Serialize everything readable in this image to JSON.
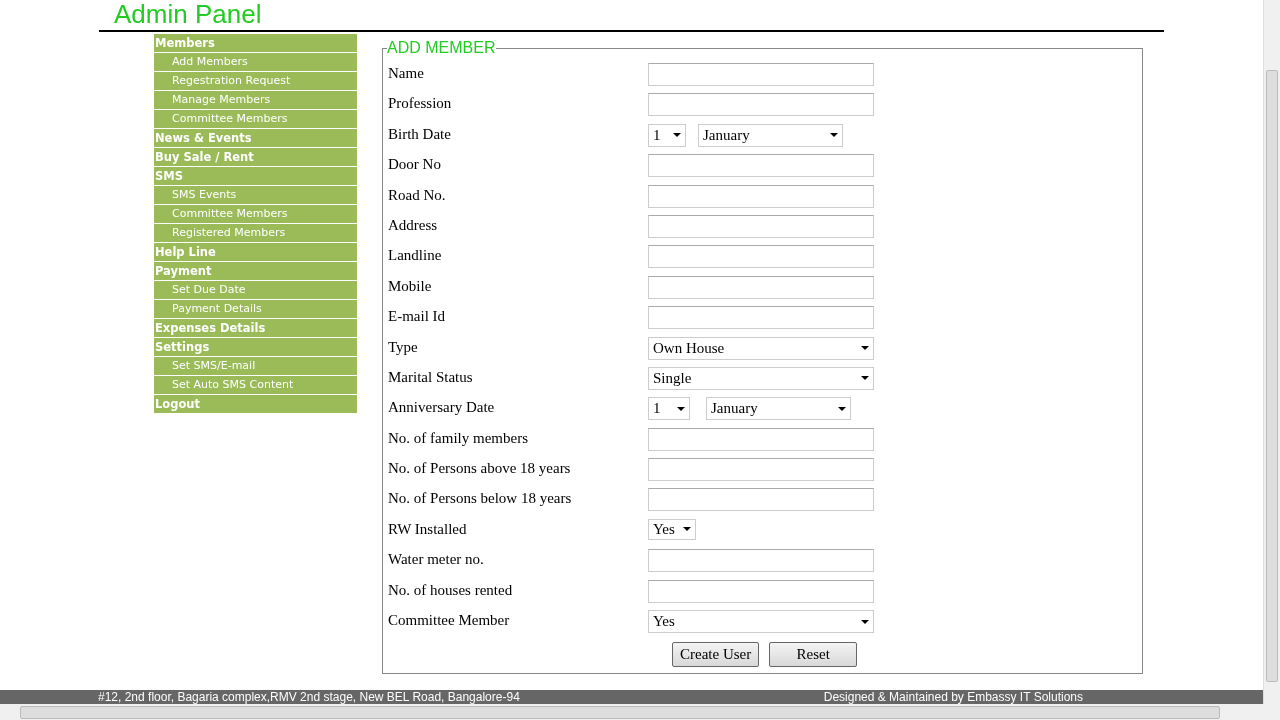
{
  "header": {
    "title": "Admin Panel"
  },
  "sidebar": {
    "items": [
      {
        "label": "Members",
        "children": [
          {
            "label": "Add Members"
          },
          {
            "label": "Regestration Request"
          },
          {
            "label": "Manage Members"
          },
          {
            "label": "Committee Members"
          }
        ]
      },
      {
        "label": "News & Events"
      },
      {
        "label": "Buy Sale / Rent"
      },
      {
        "label": "SMS",
        "children": [
          {
            "label": "SMS Events"
          },
          {
            "label": "Committee Members"
          },
          {
            "label": "Registered Members"
          }
        ]
      },
      {
        "label": "Help Line"
      },
      {
        "label": "Payment",
        "children": [
          {
            "label": "Set Due Date"
          },
          {
            "label": "Payment Details"
          }
        ]
      },
      {
        "label": "Expenses Details"
      },
      {
        "label": "Settings",
        "children": [
          {
            "label": "Set SMS/E-mail"
          },
          {
            "label": "Set Auto SMS Content"
          }
        ]
      },
      {
        "label": "Logout"
      }
    ]
  },
  "form": {
    "legend": "ADD MEMBER",
    "fields": [
      {
        "label": "Name",
        "kind": "text"
      },
      {
        "label": "Profession",
        "kind": "text"
      },
      {
        "label": "Birth Date",
        "kind": "date",
        "day": "1",
        "month": "January"
      },
      {
        "label": "Door No",
        "kind": "text"
      },
      {
        "label": "Road No.",
        "kind": "text"
      },
      {
        "label": "Address",
        "kind": "text"
      },
      {
        "label": "Landline",
        "kind": "text"
      },
      {
        "label": "Mobile",
        "kind": "text"
      },
      {
        "label": "E-mail Id",
        "kind": "text"
      },
      {
        "label": "Type",
        "kind": "select",
        "value": "Own House"
      },
      {
        "label": "Marital Status",
        "kind": "select",
        "value": "Single"
      },
      {
        "label": "Anniversary Date",
        "kind": "date",
        "day": "1",
        "month": "January"
      },
      {
        "label": "No. of family members",
        "kind": "text"
      },
      {
        "label": "No. of Persons above 18 years",
        "kind": "text"
      },
      {
        "label": "No. of Persons below 18 years",
        "kind": "text"
      },
      {
        "label": "RW Installed",
        "kind": "short_select",
        "value": "Yes"
      },
      {
        "label": "Water meter no.",
        "kind": "text"
      },
      {
        "label": "No. of houses rented",
        "kind": "text"
      },
      {
        "label": "Committee Member",
        "kind": "select",
        "value": "Yes"
      }
    ],
    "buttons": [
      "Create User",
      "Reset"
    ]
  },
  "footer": {
    "address": "#12, 2nd floor, Bagaria complex,RMV 2nd stage, New BEL Road, Bangalore-94",
    "credit": "Designed & Maintained by Embassy IT Solutions"
  }
}
